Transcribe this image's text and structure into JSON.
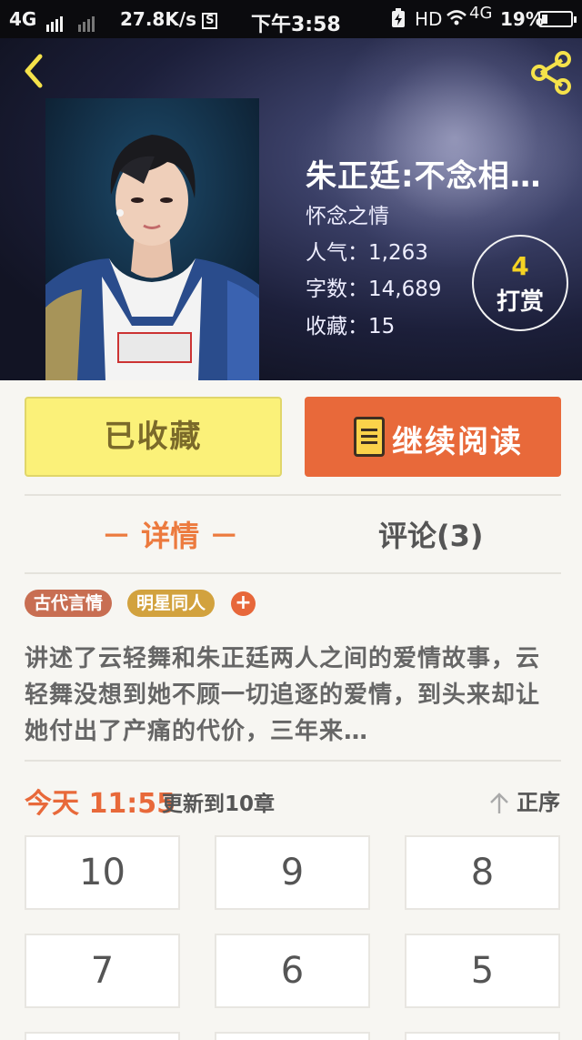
{
  "status_bar": {
    "network": "4G",
    "speed": "27.8K/s",
    "s_icon": "S",
    "time": "下午3:58",
    "hd": "HD",
    "network2": "4G",
    "battery": "19%",
    "battery_level": 0.19
  },
  "header": {
    "back_icon": "chevron-left",
    "share_icon": "share"
  },
  "book": {
    "title": "朱正廷:不念相…",
    "subtitle": "怀念之情",
    "popularity": "人气：1,263",
    "words": "字数：14,689",
    "favorites": "收藏：15",
    "reward_count": "4",
    "reward_label": "打赏"
  },
  "actions": {
    "favorited_label": "已收藏",
    "continue_label": "继续阅读"
  },
  "tabs": {
    "detail": "－ 详情 －",
    "comments": "评论(3)"
  },
  "tags": [
    "古代言情",
    "明星同人"
  ],
  "tag_add": "+",
  "description": "讲述了云轻舞和朱正廷两人之间的爱情故事，云轻舞没想到她不顾一切追逐的爱情，到头来却让她付出了产痛的代价，三年来…",
  "update": {
    "date": "今天 11:55",
    "text": "更新到10章",
    "sort_label": "正序"
  },
  "chapters": [
    "10",
    "9",
    "8",
    "7",
    "6",
    "5"
  ],
  "colors": {
    "accent": "#e8693a",
    "favorite_bg": "#fbf179",
    "tag_ancient": "#c86e52",
    "tag_star": "#d2a23e"
  }
}
